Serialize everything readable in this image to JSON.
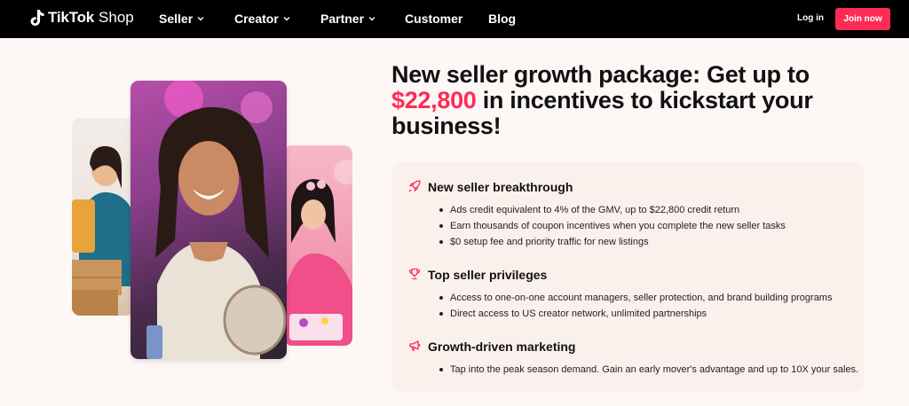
{
  "nav": {
    "brand": "TikTok",
    "brand_suffix": "Shop",
    "items": [
      {
        "label": "Seller"
      },
      {
        "label": "Creator"
      },
      {
        "label": "Partner"
      },
      {
        "label": "Customer"
      },
      {
        "label": "Blog"
      }
    ],
    "login_label": "Log in",
    "join_label": "Join now"
  },
  "hero": {
    "headline_part1": "New seller growth package: Get up to",
    "headline_amount": "$22,800",
    "headline_part2": "in incentives to kickstart your business!"
  },
  "sections": [
    {
      "icon": "rocket-icon",
      "title": "New seller breakthrough",
      "bullets": [
        "Ads credit equivalent to 4% of the GMV, up to $22,800 credit return",
        "Earn thousands of coupon incentives when you complete the new seller tasks",
        "$0 setup fee and priority traffic for new listings"
      ]
    },
    {
      "icon": "trophy-icon",
      "title": "Top seller privileges",
      "bullets": [
        "Access to one-on-one account managers, seller protection, and brand building programs",
        "Direct access to US creator network, unlimited partnerships"
      ]
    },
    {
      "icon": "megaphone-icon",
      "title": "Growth-driven marketing",
      "bullets": [
        "Tap into the peak season demand. Gain an early mover's advantage and up to 10X your sales."
      ]
    }
  ],
  "colors": {
    "accent": "#fe2c55",
    "nav_bg": "#000000",
    "card_bg": "#fbf1ec"
  }
}
